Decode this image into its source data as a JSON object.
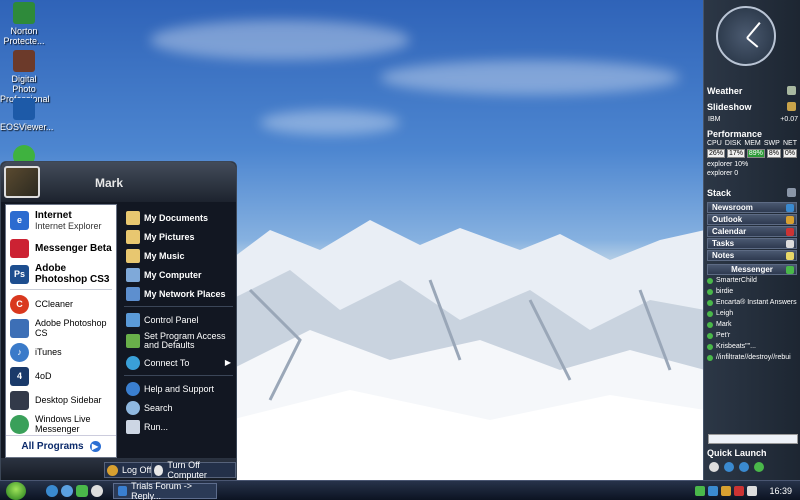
{
  "desktop": {
    "icons": [
      {
        "label": "Norton\nProtecte...",
        "color": "#2e8a3a"
      },
      {
        "label": "Digital Photo\nProfessional",
        "color": "#6c3a2a"
      },
      {
        "label": "EOSViewer...",
        "color": "#1d5aa8"
      },
      {
        "label": "",
        "color": "#3fb23f"
      }
    ]
  },
  "start_menu": {
    "user": "Mark",
    "pinned": [
      {
        "title": "Internet",
        "subtitle": "Internet Explorer",
        "icon": "ie-icon",
        "color": "#2b6bd0"
      },
      {
        "title": "Messenger Beta",
        "subtitle": "",
        "icon": "messenger-icon",
        "color": "#c23"
      },
      {
        "title": "Adobe Photoshop CS3",
        "subtitle": "",
        "icon": "photoshop-icon",
        "color": "#1d4e8f"
      }
    ],
    "recent": [
      {
        "label": "CCleaner",
        "icon": "ccleaner-icon",
        "color": "#d9381e"
      },
      {
        "label": "Adobe Photoshop CS",
        "icon": "feather-icon",
        "color": "#3d6fb6"
      },
      {
        "label": "iTunes",
        "icon": "itunes-icon",
        "color": "#3a7ac9"
      },
      {
        "label": "4oD",
        "icon": "4od-icon",
        "color": "#1a3a6a"
      },
      {
        "label": "Desktop Sidebar",
        "icon": "sidebar-icon",
        "color": "#333a4a"
      },
      {
        "label": "Windows Live Messenger",
        "icon": "wlm-icon",
        "color": "#3aa05a"
      }
    ],
    "all_programs": "All Programs",
    "right_items": [
      {
        "label": "My Documents",
        "icon": "documents-icon",
        "bold": true
      },
      {
        "label": "My Pictures",
        "icon": "pictures-icon",
        "bold": true
      },
      {
        "label": "My Music",
        "icon": "music-icon",
        "bold": true
      },
      {
        "label": "My Computer",
        "icon": "computer-icon",
        "bold": true
      },
      {
        "label": "My Network Places",
        "icon": "network-icon",
        "bold": true
      }
    ],
    "right_items2": [
      {
        "label": "Control Panel",
        "icon": "control-panel-icon"
      },
      {
        "label": "Set Program Access and Defaults",
        "icon": "defaults-icon"
      },
      {
        "label": "Connect To",
        "icon": "connect-icon"
      }
    ],
    "right_items3": [
      {
        "label": "Help and Support",
        "icon": "help-icon"
      },
      {
        "label": "Search",
        "icon": "search-icon"
      },
      {
        "label": "Run...",
        "icon": "run-icon"
      }
    ],
    "log_off": "Log Off",
    "turn_off": "Turn Off Computer"
  },
  "taskbar": {
    "task_label": "Trials Forum -> Reply...",
    "time": "16:39"
  },
  "sidebar": {
    "weather": "Weather",
    "slideshow": "Slideshow",
    "stock_name": "IBM",
    "stock_change": "+0.07",
    "performance": "Performance",
    "perf_labels": [
      "CPU",
      "DISK",
      "MEM",
      "SWP",
      "NET"
    ],
    "perf_values": [
      "26%",
      "17%",
      "89%",
      "8%",
      "0%"
    ],
    "proc1": "explorer 10%",
    "proc2": "explorer 0",
    "stack": "Stack",
    "newsroom": "Newsroom",
    "outlook": "Outlook",
    "calendar": "Calendar",
    "tasks": "Tasks",
    "notes": "Notes",
    "messenger": "Messenger",
    "contacts": [
      "SmarterChild",
      "birdie",
      "Encarta® Instant Answers",
      "Leigh",
      "Mark",
      "Pet'r",
      "Krisbeats\"\"...",
      "//infiltrate//destroy//rebui"
    ],
    "quick_launch": "Quick Launch"
  }
}
